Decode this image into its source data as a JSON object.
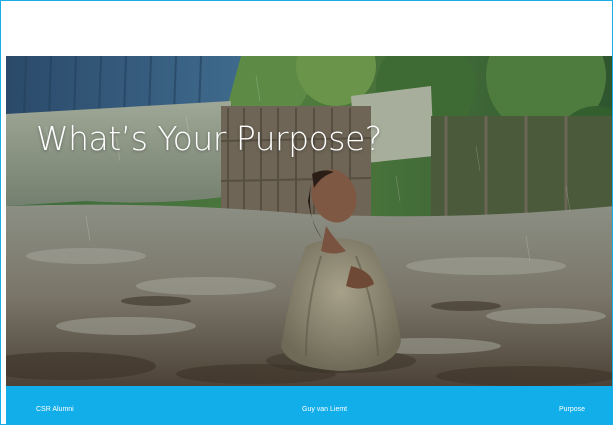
{
  "slide": {
    "title": "What’s Your Purpose?",
    "footer_left": "CSR Alumni",
    "footer_center": "Guy van Liemt",
    "footer_right": "Purpose"
  },
  "theme": {
    "accent": "#12aee9",
    "border": "#1aaee6",
    "background": "#ffffff",
    "title_color": "#ffffff"
  },
  "image": {
    "subject": "child kneeling in rain on muddy ground"
  }
}
